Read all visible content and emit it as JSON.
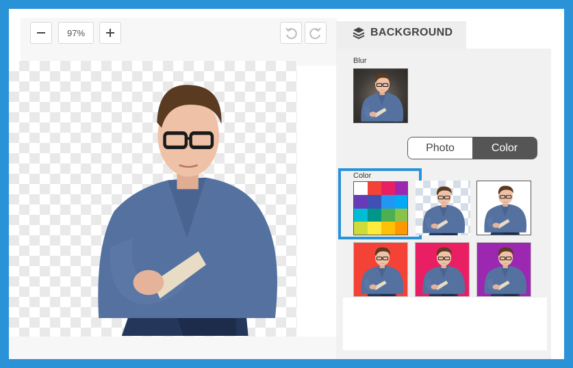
{
  "toolbar": {
    "zoom_out_icon": "minus-icon",
    "zoom_value": "97%",
    "zoom_in_icon": "plus-icon",
    "undo_icon": "undo-icon",
    "redo_icon": "redo-icon"
  },
  "panel": {
    "title": "BACKGROUND",
    "title_icon": "layers-icon",
    "blur_label": "Blur",
    "toggle": {
      "photo_label": "Photo",
      "color_label": "Color",
      "selected": "Color"
    },
    "color_label": "Color",
    "swatches": [
      "#ffffff",
      "#f44336",
      "#e91e63",
      "#9c27b0",
      "#673ab7",
      "#3f51b5",
      "#2196f3",
      "#03a9f4",
      "#00bcd4",
      "#009688",
      "#4caf50",
      "#8bc34a",
      "#cddc39",
      "#ffeb3b",
      "#ffc107",
      "#ff9800"
    ],
    "presets": [
      {
        "name": "transparent"
      },
      {
        "name": "white",
        "color": "#ffffff"
      },
      {
        "name": "red",
        "color": "#f44336"
      },
      {
        "name": "pink",
        "color": "#e91e63"
      },
      {
        "name": "purple",
        "color": "#9c27b0"
      }
    ]
  },
  "colors": {
    "accent": "#2a93d8",
    "toggle_active": "#555555"
  }
}
